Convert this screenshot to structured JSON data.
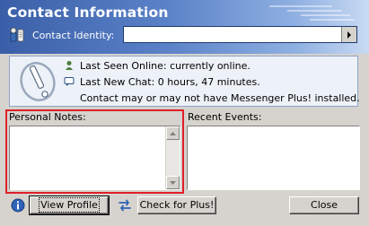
{
  "header": {
    "title": "Contact Information",
    "identity_label": "Contact Identity:",
    "identity_value": ""
  },
  "info": {
    "last_seen": "Last Seen Online: currently online.",
    "last_chat": "Last New Chat: 0 hours, 47 minutes.",
    "plus_status": "Contact may or may not have Messenger Plus! installed."
  },
  "notes": {
    "label": "Personal Notes:",
    "value": ""
  },
  "events": {
    "label": "Recent Events:",
    "value": ""
  },
  "buttons": {
    "view_profile": "View Profile",
    "check_plus": "Check for Plus!",
    "close": "Close"
  },
  "colors": {
    "header_start": "#3a5fa8",
    "header_end": "#c9daf3",
    "info_bg": "#edf1f8",
    "highlight": "#e0202a"
  },
  "icons": [
    "identity-icon",
    "dropdown-arrow-icon",
    "messenger-plus-logo-icon",
    "user-online-icon",
    "chat-bubble-icon",
    "info-icon",
    "refresh-arrows-icon"
  ]
}
